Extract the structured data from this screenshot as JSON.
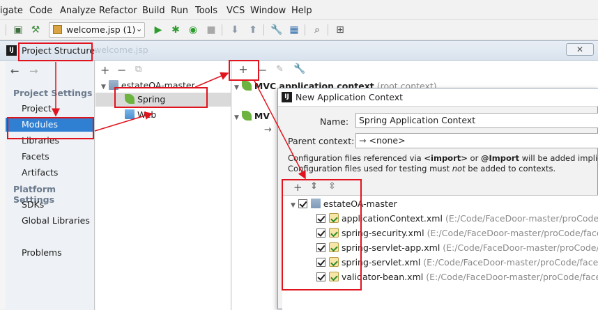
{
  "menu": [
    "igate",
    "Code",
    "Analyze",
    "Refactor",
    "Build",
    "Run",
    "Tools",
    "VCS",
    "Window",
    "Help"
  ],
  "toolbar": {
    "run_config": "welcome.jsp (1)"
  },
  "ps": {
    "title": "Project Structure",
    "bg_title": "welcome.jsp",
    "nav": {
      "project_settings": "Project Settings",
      "project": "Project",
      "modules": "Modules",
      "libraries": "Libraries",
      "facets": "Facets",
      "artifacts": "Artifacts",
      "platform_settings": "Platform Settings",
      "sdks": "SDKs",
      "global_libraries": "Global Libraries",
      "problems": "Problems"
    },
    "tree": {
      "root": "estateOA-master",
      "spring": "Spring",
      "web": "Web"
    },
    "right": {
      "mvc1": "MVC application context",
      "mvc1_sub": "(root context)",
      "mvc2": "MV"
    }
  },
  "nac": {
    "title": "New Application Context",
    "name_label": "Name:",
    "name_value": "Spring Application Context",
    "parent_label": "Parent context:",
    "parent_value": "<none>",
    "info1_a": "Configuration files referenced via ",
    "info1_b": "<import>",
    "info1_c": " or ",
    "info1_d": "@Import",
    "info1_e": " will be added implicitly.",
    "info2_a": "Configuration files used for testing must ",
    "info2_b": "not",
    "info2_c": " be added to contexts.",
    "root": "estateOA-master",
    "files": [
      {
        "name": "applicationContext.xml",
        "path": "(E:/Code/FaceDoor-master/proCode/face"
      },
      {
        "name": "spring-security.xml",
        "path": "(E:/Code/FaceDoor-master/proCode/facedo"
      },
      {
        "name": "spring-servlet-app.xml",
        "path": "(E:/Code/FaceDoor-master/proCode/face"
      },
      {
        "name": "spring-servlet.xml",
        "path": "(E:/Code/FaceDoor-master/proCode/facedoo"
      },
      {
        "name": "validator-bean.xml",
        "path": "(E:/Code/FaceDoor-master/proCode/facedo"
      }
    ]
  },
  "colors": {
    "selection": "#2f7fd3",
    "annotation": "#e0141e"
  }
}
